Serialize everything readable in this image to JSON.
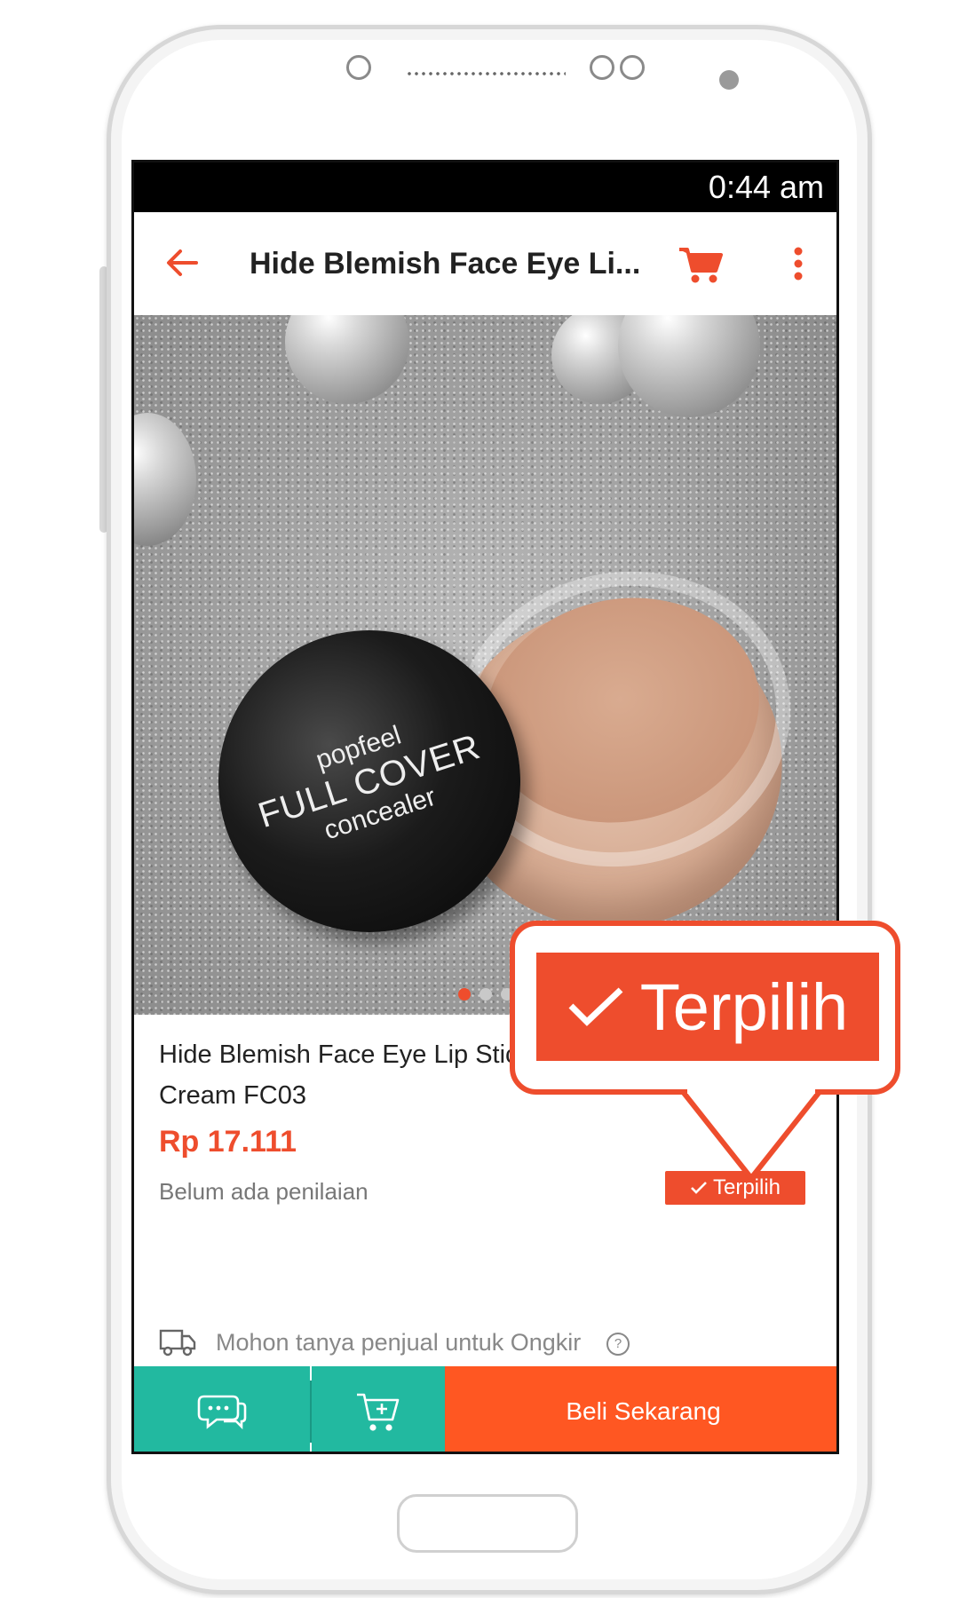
{
  "statusbar": {
    "time": "0:44 am"
  },
  "appbar": {
    "title": "Hide Blemish Face Eye Li...",
    "back_icon": "arrow-left-icon",
    "cart_icon": "cart-icon",
    "more_icon": "more-vert-icon"
  },
  "product_image": {
    "lid_brand": "popfeel",
    "lid_main": "FULL COVER",
    "lid_sub": "concealer"
  },
  "product": {
    "name": "Hide Blemish Face Eye Lip Stick Make-up Concealer Cream FC03",
    "price": "Rp 17.111",
    "rating_text": "Belum ada penilaian",
    "badge": "Terpilih"
  },
  "shipping": {
    "text": "Mohon tanya penjual untuk Ongkir"
  },
  "bottom_bar": {
    "buy_now": "Beli Sekarang"
  },
  "callout": {
    "label": "Terpilih"
  },
  "colors": {
    "accent": "#ee4d2d",
    "teal": "#22b9a0",
    "buy": "#ff5722"
  }
}
